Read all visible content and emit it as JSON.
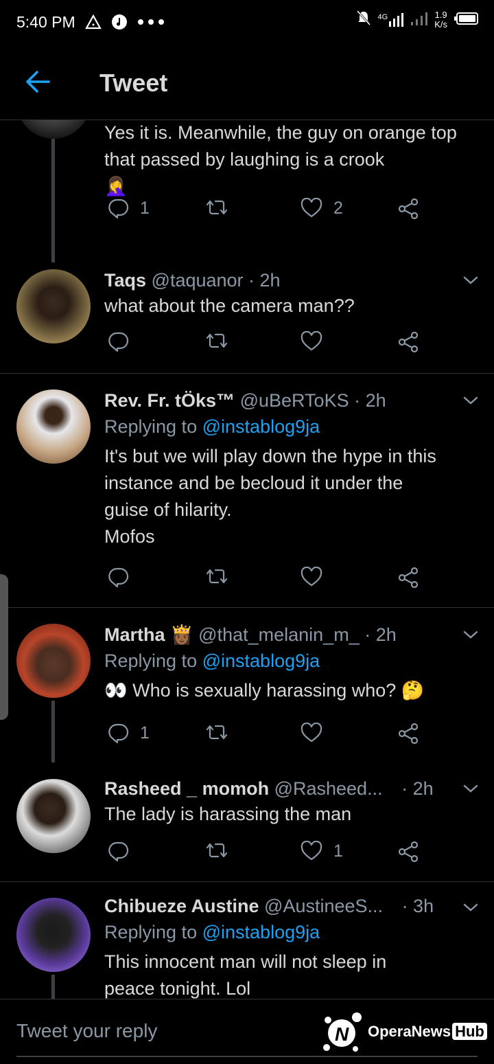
{
  "status_bar": {
    "time": "5:40 PM",
    "left_icons": [
      "warning-triangle-icon",
      "music-note-icon",
      "more-dots-icon"
    ],
    "network": "4G",
    "speed_value": "1.9",
    "speed_unit": "K/s"
  },
  "header": {
    "title": "Tweet",
    "back_icon": "arrow-left-icon"
  },
  "tweets": [
    {
      "body": "Yes it is. Meanwhile, the guy on orange top that passed by laughing is a crook",
      "emoji": "🤦‍♀️",
      "replies": "1",
      "retweets": "",
      "likes": "2"
    },
    {
      "name": "Taqs",
      "handle": "@taquanor",
      "time": "· 2h",
      "body": "what about the camera man??",
      "replies": "",
      "retweets": "",
      "likes": ""
    },
    {
      "name": "Rev. Fr. tÖks™",
      "handle": "@uBeRToKS",
      "time": "· 2h",
      "replying_label": "Replying to",
      "replying_to": "@instablog9ja",
      "body_lines": [
        "It's but we will play down the hype in this",
        "instance and be becloud it under the",
        "guise of hilarity.",
        "Mofos"
      ],
      "replies": "",
      "retweets": "",
      "likes": ""
    },
    {
      "name": "Martha",
      "name_emoji": "👸🏾",
      "handle": "@that_melanin_m_",
      "time": "· 2h",
      "replying_label": "Replying to",
      "replying_to": "@instablog9ja",
      "body_prefix": "👀",
      "body": "Who is sexually harassing who?",
      "body_suffix": "🤔",
      "replies": "1",
      "retweets": "",
      "likes": ""
    },
    {
      "name": "Rasheed _ momoh",
      "handle": "@Rasheed...",
      "time": "· 2h",
      "body": "The lady is harassing the man",
      "replies": "",
      "retweets": "",
      "likes": "1"
    },
    {
      "name": "Chibueze Austine",
      "handle": "@AustineeS...",
      "time": "· 3h",
      "replying_label": "Replying to",
      "replying_to": "@instablog9ja",
      "body_lines": [
        "This innocent man will not sleep in",
        "peace tonight. Lol"
      ]
    }
  ],
  "composer": {
    "placeholder": "Tweet your reply"
  },
  "watermark": {
    "text": "OperaNews",
    "hub": "Hub"
  },
  "colors": {
    "accent": "#1da1f2",
    "background": "#000000",
    "muted": "#8b98a5",
    "divider": "#2f3336"
  }
}
